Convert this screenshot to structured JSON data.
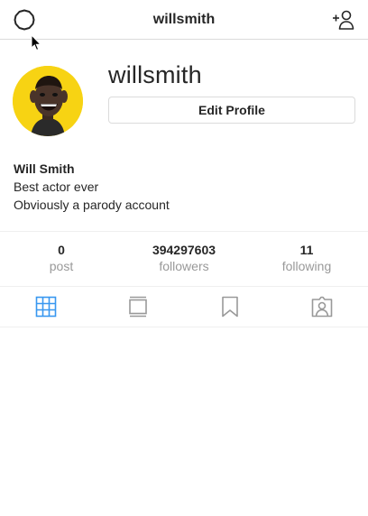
{
  "header": {
    "title": "willsmith",
    "left_icon": "settings-gear-icon",
    "right_icon": "add-user-icon"
  },
  "profile": {
    "username": "willsmith",
    "edit_button_label": "Edit Profile",
    "avatar_background": "#f7d313"
  },
  "bio": {
    "full_name": "Will Smith",
    "lines": [
      "Best actor ever",
      "Obviously a parody account"
    ]
  },
  "stats": [
    {
      "value": "0",
      "label": "post"
    },
    {
      "value": "394297603",
      "label": "followers"
    },
    {
      "value": "11",
      "label": "following"
    }
  ],
  "tabs": [
    {
      "icon": "grid-icon",
      "active": true
    },
    {
      "icon": "feed-list-icon",
      "active": false
    },
    {
      "icon": "bookmark-icon",
      "active": false
    },
    {
      "icon": "tagged-person-icon",
      "active": false
    }
  ],
  "colors": {
    "active_tab": "#3897f0",
    "inactive_icon": "#999999",
    "text": "#262626",
    "muted_text": "#999999",
    "border": "#dbdbdb"
  }
}
